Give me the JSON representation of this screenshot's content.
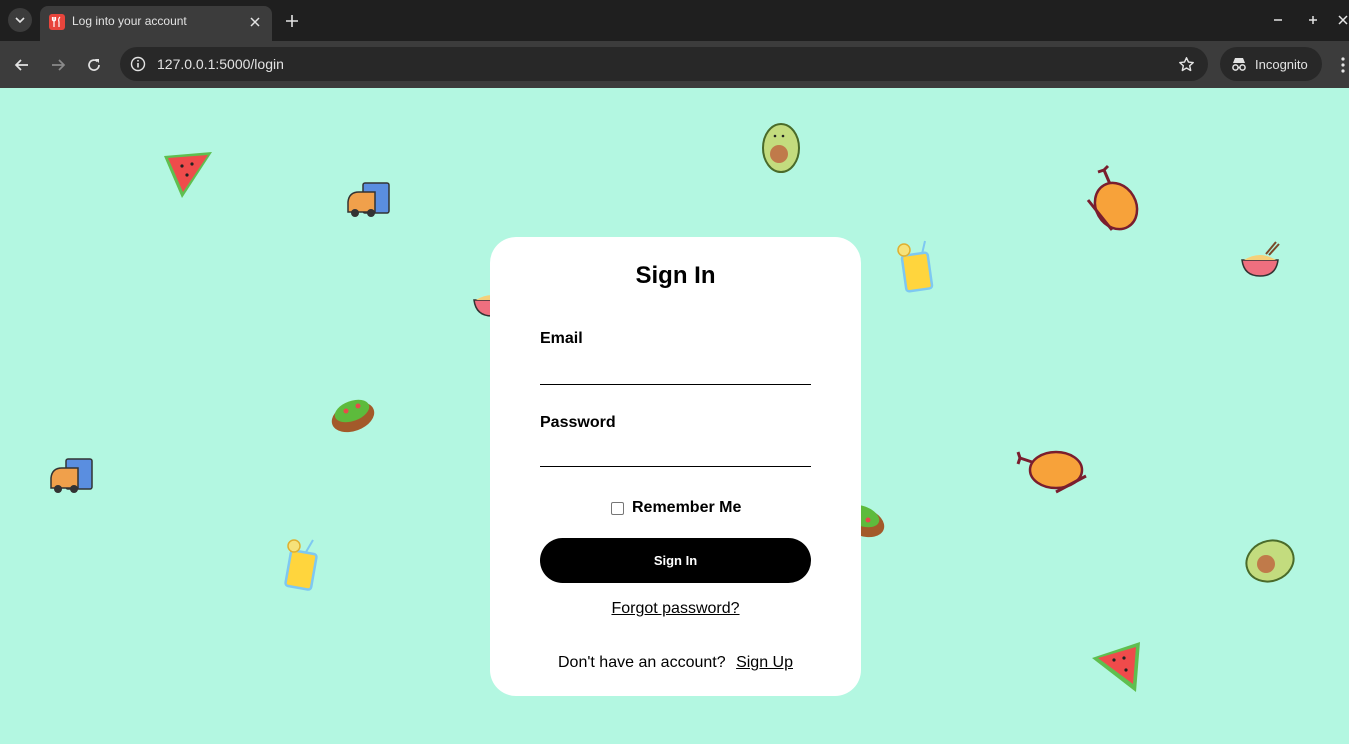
{
  "browser": {
    "tab_title": "Log into your account",
    "url": "127.0.0.1:5000/login",
    "incognito_label": "Incognito"
  },
  "login": {
    "title": "Sign In",
    "email_label": "Email",
    "email_value": "",
    "password_label": "Password",
    "password_value": "",
    "remember_label": "Remember Me",
    "remember_checked": false,
    "submit_label": "Sign In",
    "forgot_label": "Forgot password?",
    "no_account_text": "Don't have an account?",
    "signup_label": "Sign Up"
  },
  "colors": {
    "page_background": "#b3f7e1",
    "card_background": "#ffffff",
    "button_background": "#000000",
    "chrome_dark": "#1f1f1f",
    "chrome_toolbar": "#3c3c3c"
  },
  "decorations": [
    "watermelon-icon",
    "food-truck-icon",
    "avocado-icon",
    "roast-chicken-icon",
    "noodle-bowl-icon",
    "juice-cup-icon",
    "salad-bowl-icon"
  ]
}
